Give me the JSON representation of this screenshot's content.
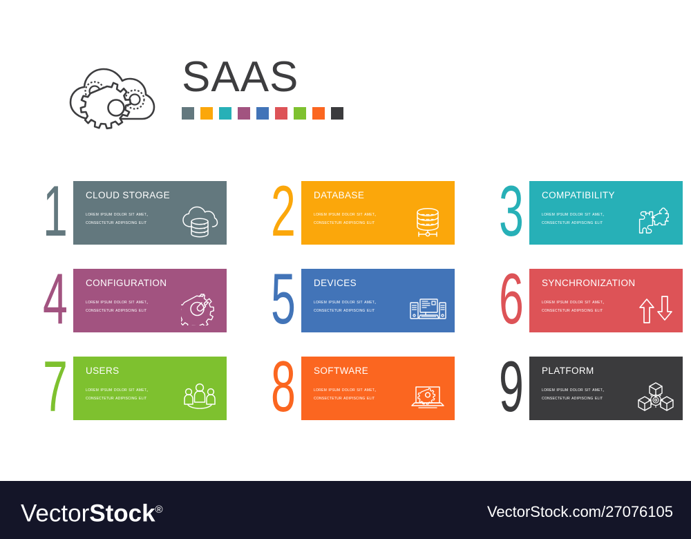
{
  "header": {
    "title": "SAAS",
    "title_color": "#3d3d3f",
    "brand_icon": "cloud-gears-icon",
    "palette": [
      {
        "name": "slate",
        "hex": "#63787e"
      },
      {
        "name": "amber",
        "hex": "#fba70b"
      },
      {
        "name": "teal",
        "hex": "#27b0b7"
      },
      {
        "name": "plum",
        "hex": "#a25380"
      },
      {
        "name": "blue",
        "hex": "#4274b8"
      },
      {
        "name": "red",
        "hex": "#dd5357"
      },
      {
        "name": "green",
        "hex": "#7ec12f"
      },
      {
        "name": "orange",
        "hex": "#fb6620"
      },
      {
        "name": "dark",
        "hex": "#3b3b3d"
      }
    ]
  },
  "cards": [
    {
      "number": "1",
      "title": "CLOUD STORAGE",
      "description": "Lorem ipsum dolor sit amet, consectetur adipiscing elit",
      "color": "#63787e",
      "icon": "cloud-database-icon"
    },
    {
      "number": "2",
      "title": "DATABASE",
      "description": "Lorem ipsum dolor sit amet, consectetur adipiscing elit",
      "color": "#fba70b",
      "icon": "database-icon"
    },
    {
      "number": "3",
      "title": "COMPATIBILITY",
      "description": "Lorem ipsum dolor sit amet, consectetur adipiscing elit",
      "color": "#27b0b7",
      "icon": "puzzle-pieces-icon"
    },
    {
      "number": "4",
      "title": "CONFIGURATION",
      "description": "Lorem ipsum dolor sit amet, consectetur adipiscing elit",
      "color": "#a25380",
      "icon": "gear-wrench-icon"
    },
    {
      "number": "5",
      "title": "DEVICES",
      "description": "Lorem ipsum dolor sit amet, consectetur adipiscing elit",
      "color": "#4274b8",
      "icon": "devices-icon"
    },
    {
      "number": "6",
      "title": "SYNCHRONIZATION",
      "description": "Lorem ipsum dolor sit amet, consectetur adipiscing elit",
      "color": "#dd5357",
      "icon": "sync-arrows-icon"
    },
    {
      "number": "7",
      "title": "USERS",
      "description": "Lorem ipsum dolor sit amet, consectetur adipiscing elit",
      "color": "#7ec12f",
      "icon": "users-group-icon"
    },
    {
      "number": "8",
      "title": "SOFTWARE",
      "description": "Lorem ipsum dolor sit amet, consectetur adipiscing elit",
      "color": "#fb6620",
      "icon": "laptop-gear-icon"
    },
    {
      "number": "9",
      "title": "PLATFORM",
      "description": "Lorem ipsum dolor sit amet, consectetur adipiscing elit",
      "color": "#3b3b3d",
      "icon": "cubes-network-icon"
    }
  ],
  "footer": {
    "logo_part1": "Vector",
    "logo_part2": "Stock",
    "logo_registered": "®",
    "url": "VectorStock.com/27076105",
    "background": "#141528"
  }
}
